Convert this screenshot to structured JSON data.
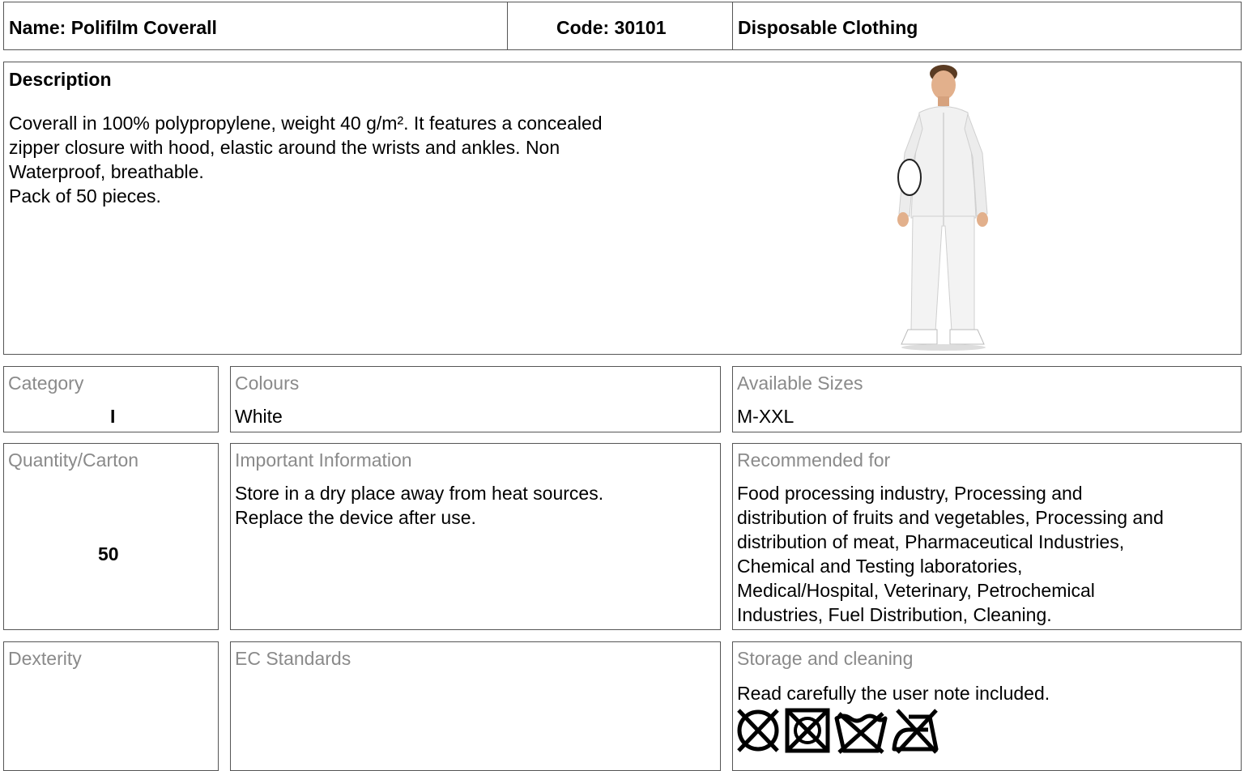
{
  "header": {
    "name": "Name: Polifilm Coverall",
    "code": "Code: 30101",
    "category": "Disposable Clothing"
  },
  "description": {
    "title": "Description",
    "lines": [
      "Coverall in 100% polypropylene, weight 40 g/m².  It features a concealed",
      "zipper closure with hood, elastic around the wrists and ankles. Non",
      "Waterproof, breathable.",
      "Pack of 50 pieces."
    ],
    "image": "man-in-white-coverall-photo"
  },
  "fields": {
    "category": {
      "label": "Category",
      "value": "I"
    },
    "colours": {
      "label": "Colours",
      "value": "White"
    },
    "sizes": {
      "label": "Available Sizes",
      "value": "M-XXL"
    },
    "quantity": {
      "label": "Quantity/Carton",
      "value": "50"
    },
    "important": {
      "label": "Important Information",
      "lines": [
        "Store in a dry place away from heat sources.",
        "Replace the device after use."
      ]
    },
    "recommended": {
      "label": "Recommended for",
      "lines": [
        "Food processing industry, Processing and",
        "distribution of fruits and vegetables, Processing and",
        "distribution of meat, Pharmaceutical Industries,",
        "Chemical and Testing laboratories,",
        "Medical/Hospital, Veterinary, Petrochemical",
        "Industries, Fuel Distribution, Cleaning."
      ]
    },
    "dexterity": {
      "label": "Dexterity",
      "value": ""
    },
    "standards": {
      "label": "EC Standards",
      "value": ""
    },
    "storage": {
      "label": "Storage and cleaning",
      "value": "Read carefully the user note included.",
      "icons": [
        "do-not-bleach-icon",
        "do-not-tumble-dry-icon",
        "do-not-wash-icon",
        "do-not-iron-icon"
      ]
    }
  }
}
